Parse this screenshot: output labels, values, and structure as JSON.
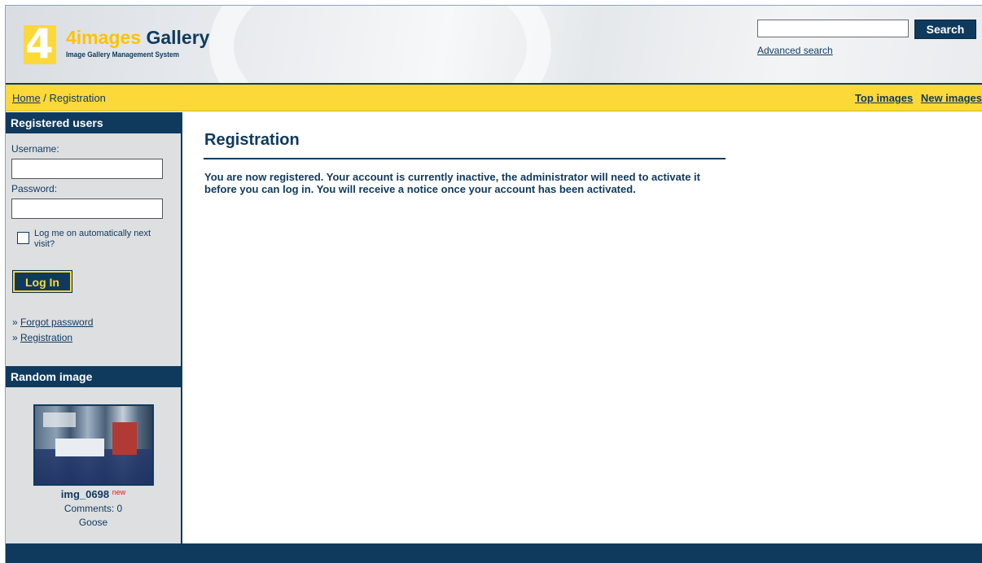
{
  "header": {
    "logo_number": "4",
    "logo_title_a": "4images",
    "logo_title_b": " Gallery",
    "logo_subtitle": "Image Gallery Management System",
    "search": {
      "value": "",
      "button_label": "Search",
      "advanced_label": "Advanced search"
    }
  },
  "nav": {
    "breadcrumb_home": "Home",
    "breadcrumb_separator": " / ",
    "breadcrumb_current": "Registration",
    "top_images": "Top images",
    "new_images": "New images"
  },
  "sidebar": {
    "registered_heading": "Registered users",
    "username_label": "Username:",
    "username_value": "",
    "password_label": "Password:",
    "password_value": "",
    "remember_label": "Log me on automatically next visit?",
    "remember_checked": false,
    "login_button": "Log In",
    "link_prefix": "» ",
    "forgot_password": "Forgot password",
    "registration": "Registration",
    "random_heading": "Random image",
    "random_image": {
      "name": "img_0698",
      "badge": "new",
      "comments": "Comments: 0",
      "user": "Goose"
    }
  },
  "content": {
    "title": "Registration",
    "message": "You are now registered. Your account is currently inactive, the administrator will need to activate it before you can log in. You will receive a notice once your account has been activated."
  },
  "colors": {
    "navy": "#0f3a5e",
    "yellow": "#fdd839",
    "sidebar_bg": "#dddfe1",
    "new_badge": "#e21b1b"
  }
}
